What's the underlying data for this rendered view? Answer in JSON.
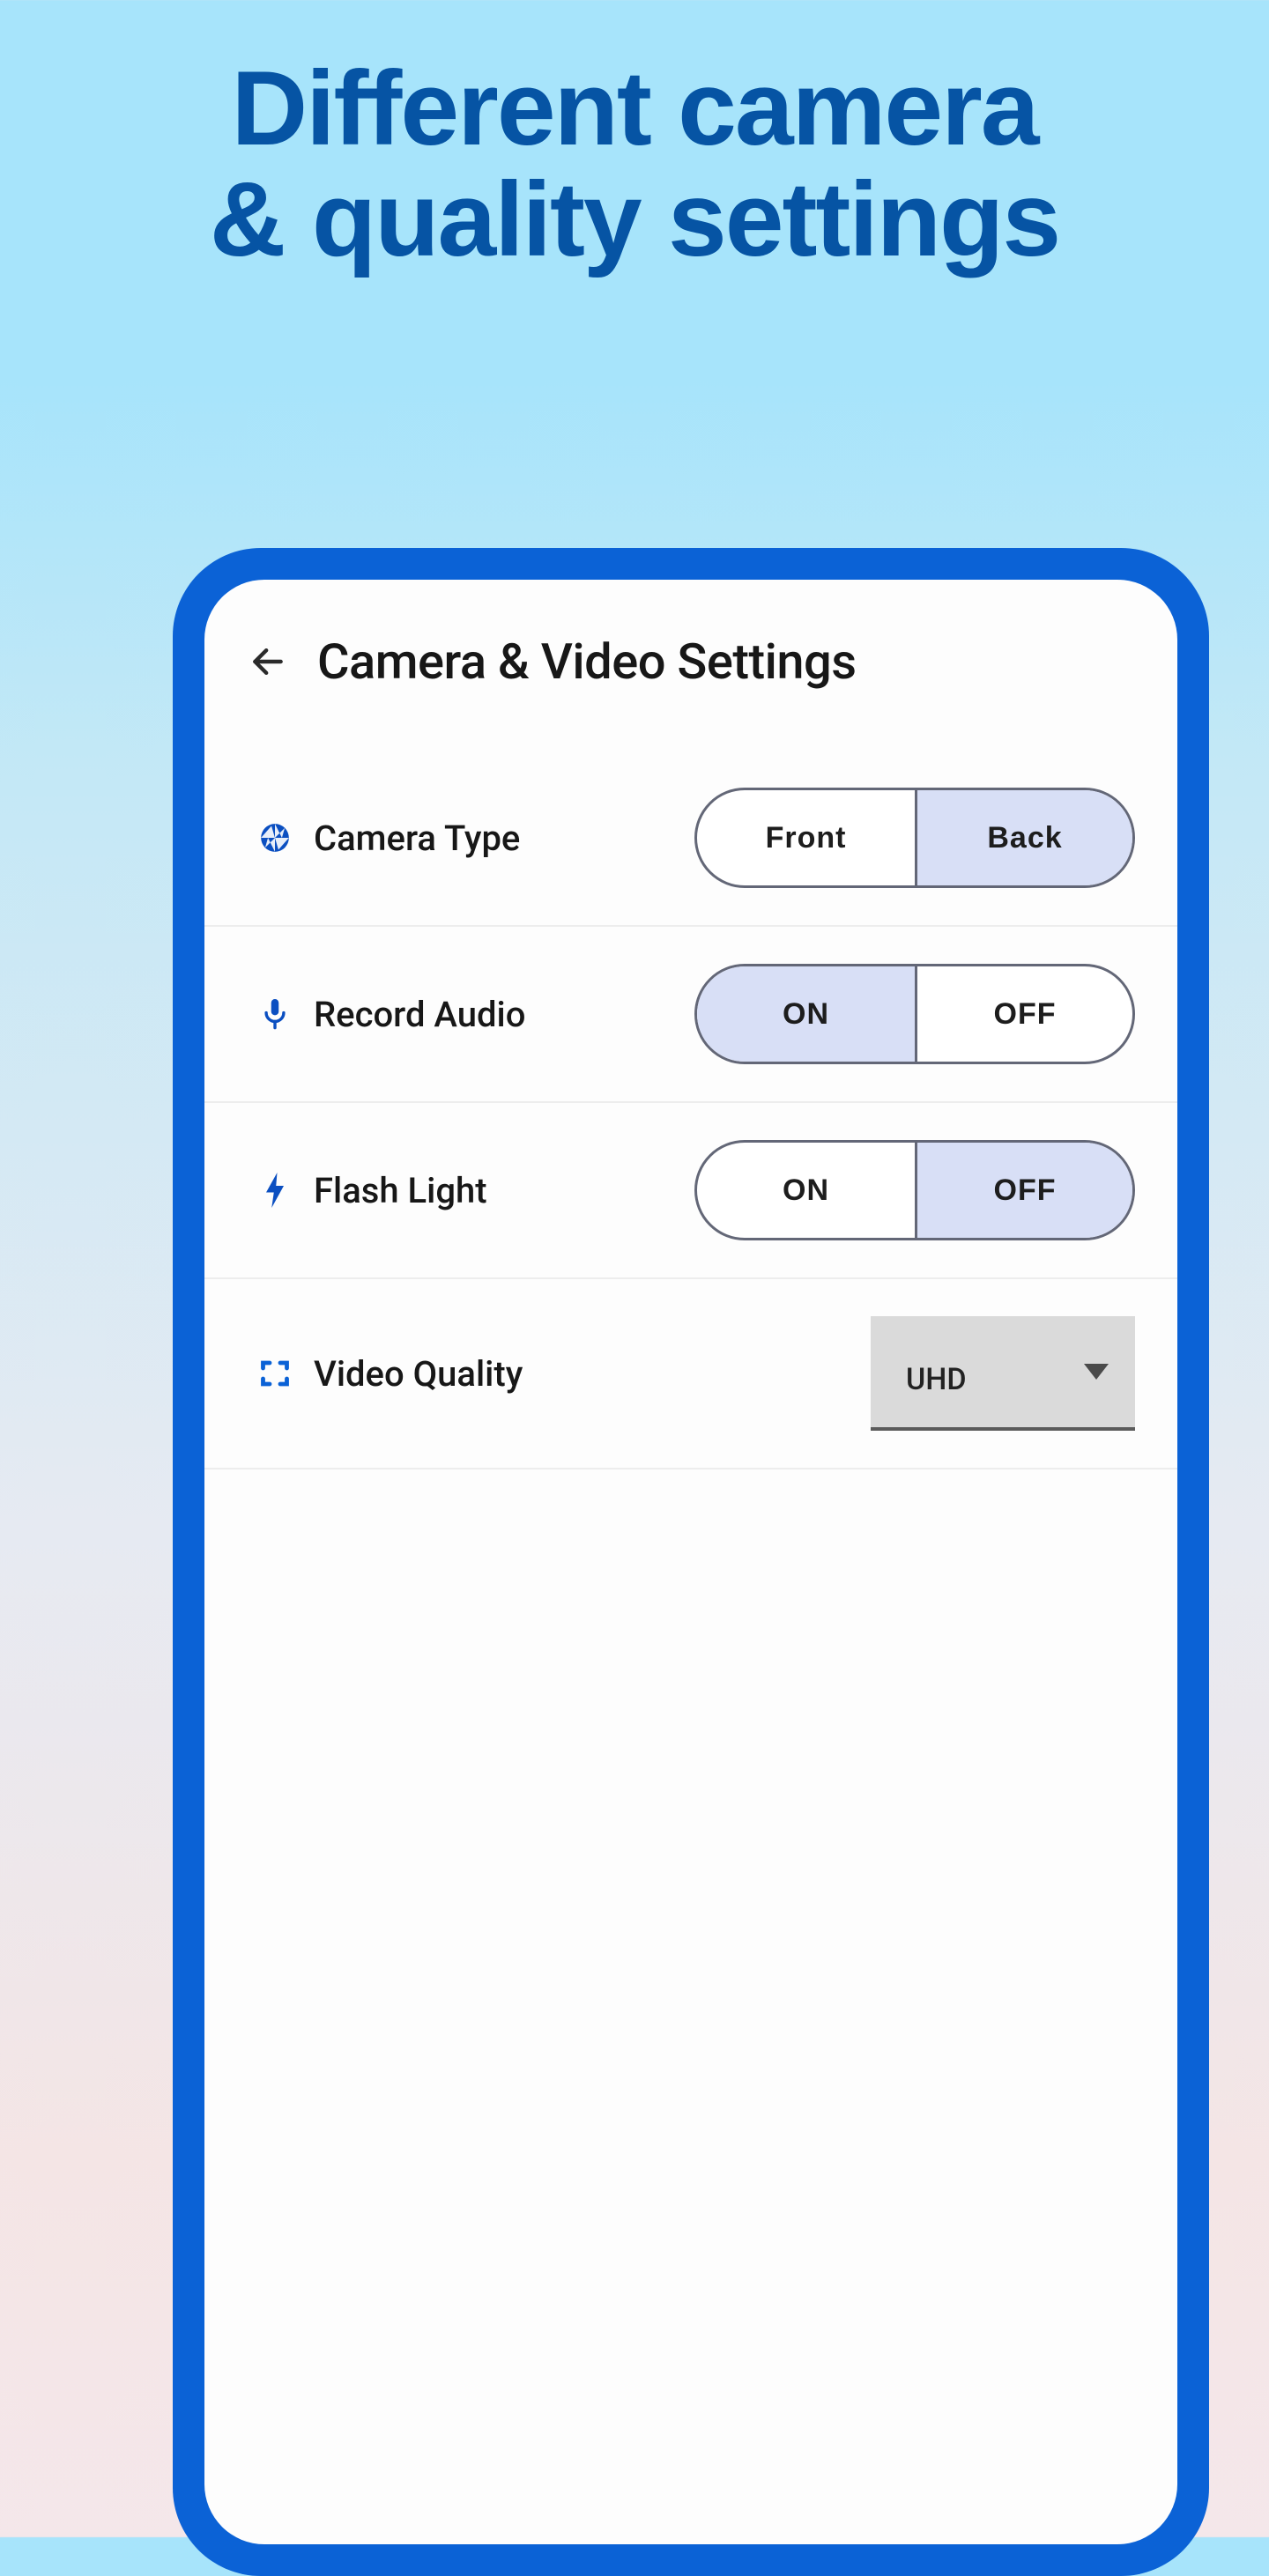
{
  "promo": {
    "line1": "Different camera",
    "line2": "& quality settings"
  },
  "screen": {
    "title": "Camera & Video Settings"
  },
  "settings": {
    "camera_type": {
      "label": "Camera Type",
      "option_left": "Front",
      "option_right": "Back",
      "selected": "Back"
    },
    "record_audio": {
      "label": "Record Audio",
      "option_left": "ON",
      "option_right": "OFF",
      "selected": "ON"
    },
    "flash_light": {
      "label": "Flash Light",
      "option_left": "ON",
      "option_right": "OFF",
      "selected": "OFF"
    },
    "video_quality": {
      "label": "Video Quality",
      "value": "UHD"
    }
  },
  "colors": {
    "accent": "#0B62D6",
    "heading": "#0654A4",
    "segment_active_bg": "#D8DFF6",
    "segment_border": "#636777"
  }
}
